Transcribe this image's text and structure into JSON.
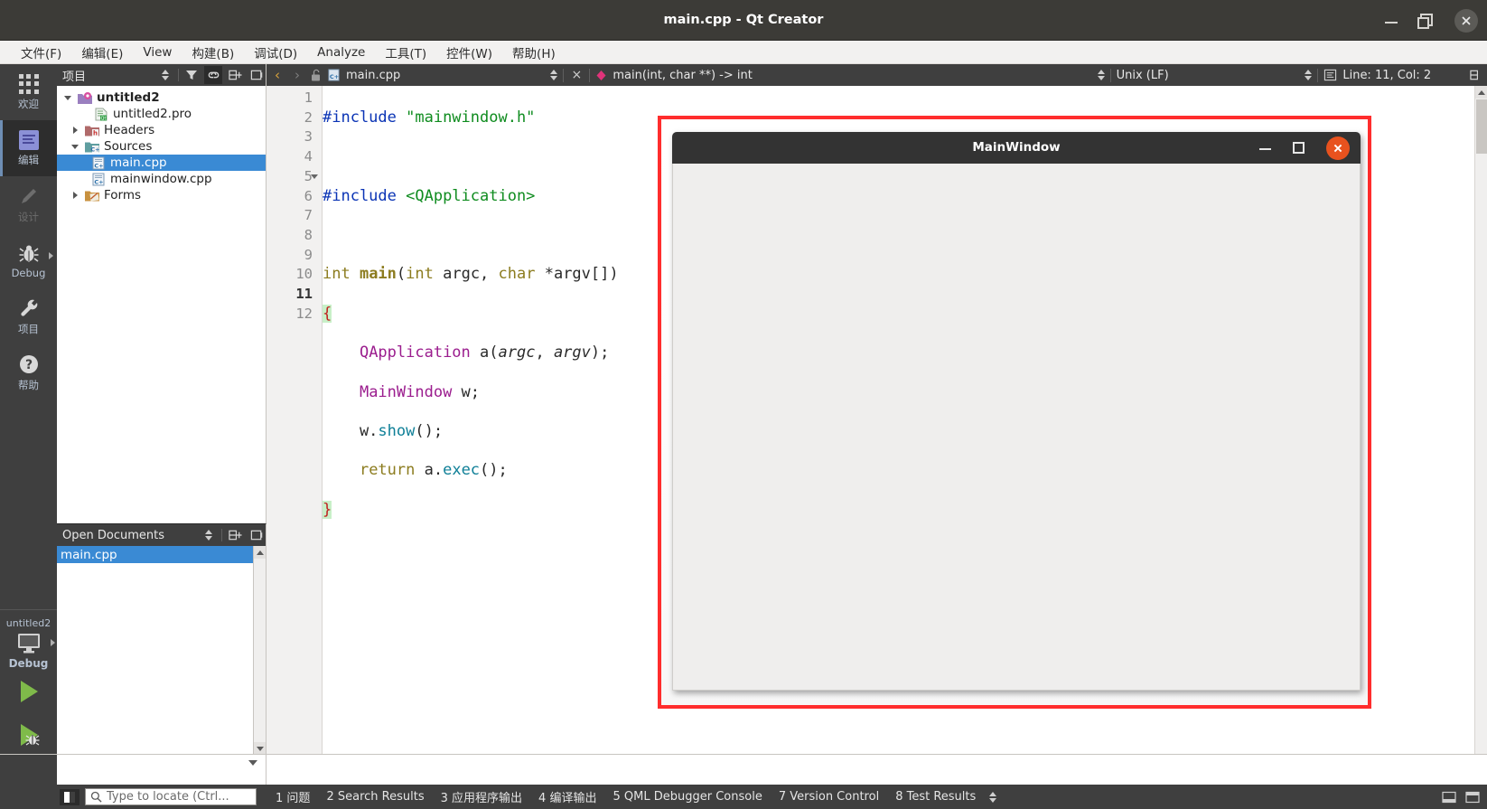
{
  "titlebar": {
    "title": "main.cpp - Qt Creator",
    "minimize": "minimize",
    "restore": "restore",
    "close": "close"
  },
  "menubar": {
    "items": [
      {
        "label": "文件(F)",
        "mnemonic": "F"
      },
      {
        "label": "编辑(E)",
        "mnemonic": "E"
      },
      {
        "label": "View",
        "mnemonic": "V"
      },
      {
        "label": "构建(B)",
        "mnemonic": "B"
      },
      {
        "label": "调试(D)",
        "mnemonic": "D"
      },
      {
        "label": "Analyze",
        "mnemonic": "A"
      },
      {
        "label": "工具(T)",
        "mnemonic": "T"
      },
      {
        "label": "控件(W)",
        "mnemonic": "W"
      },
      {
        "label": "帮助(H)",
        "mnemonic": "H"
      }
    ]
  },
  "modebar": {
    "items": [
      {
        "label": "欢迎",
        "icon": "grid-icon",
        "state": "normal"
      },
      {
        "label": "编辑",
        "icon": "edit-document-icon",
        "state": "active"
      },
      {
        "label": "设计",
        "icon": "pencil-icon",
        "state": "disabled"
      },
      {
        "label": "Debug",
        "icon": "bug-icon",
        "state": "normal"
      },
      {
        "label": "项目",
        "icon": "wrench-icon",
        "state": "normal"
      },
      {
        "label": "帮助",
        "icon": "question-mark-icon",
        "state": "normal"
      }
    ],
    "kit": {
      "project": "untitled2",
      "build_config": "Debug",
      "icon": "monitor-icon",
      "run_label": "run",
      "debug_label": "start-debugging",
      "build_label": "build"
    }
  },
  "project_pane": {
    "title": "项目",
    "toolbar_icons": [
      "sort-icon",
      "filter-icon",
      "link-icon",
      "split-icon",
      "close-icon"
    ],
    "tree": [
      {
        "label": "untitled2",
        "icon": "qt-project-icon",
        "depth": 0,
        "expander": "down",
        "bold": true,
        "selected": false
      },
      {
        "label": "untitled2.pro",
        "icon": "pro-file-icon",
        "depth": 1,
        "expander": "none",
        "bold": false,
        "selected": false
      },
      {
        "label": "Headers",
        "icon": "headers-folder-icon",
        "depth": 1,
        "expander": "right",
        "bold": false,
        "selected": false
      },
      {
        "label": "Sources",
        "icon": "sources-folder-icon",
        "depth": 1,
        "expander": "down",
        "bold": false,
        "selected": false
      },
      {
        "label": "main.cpp",
        "icon": "cpp-file-icon",
        "depth": 2,
        "expander": "none",
        "bold": false,
        "selected": true
      },
      {
        "label": "mainwindow.cpp",
        "icon": "cpp-file-icon",
        "depth": 2,
        "expander": "none",
        "bold": false,
        "selected": false
      },
      {
        "label": "Forms",
        "icon": "forms-folder-icon",
        "depth": 1,
        "expander": "right",
        "bold": false,
        "selected": false
      }
    ]
  },
  "open_documents": {
    "title": "Open Documents",
    "toolbar_icons": [
      "sort-icon",
      "split-icon",
      "close-icon"
    ],
    "items": [
      {
        "label": "main.cpp",
        "selected": true
      }
    ]
  },
  "editor_toolbar": {
    "back": "‹",
    "forward": "›",
    "lock_icon": "unlocked-icon",
    "file_icon": "cpp-file-icon",
    "filename": "main.cpp",
    "close_tab": "×",
    "symbol_icon": "function-symbol-icon",
    "symbol": "main(int, char **) -> int",
    "line_ending": "Unix (LF)",
    "text_encoding_icon": "text-settings-icon",
    "cursor_position": "Line: 11, Col: 2",
    "split_icon": "split-icon"
  },
  "editor": {
    "lines": [
      {
        "n": 1,
        "fold": false,
        "tokens": [
          {
            "t": "#include ",
            "c": "k-pre"
          },
          {
            "t": "\"mainwindow.h\"",
            "c": "k-str"
          }
        ]
      },
      {
        "n": 2,
        "fold": false,
        "tokens": []
      },
      {
        "n": 3,
        "fold": false,
        "tokens": [
          {
            "t": "#include ",
            "c": "k-pre"
          },
          {
            "t": "<QApplication>",
            "c": "k-str"
          }
        ]
      },
      {
        "n": 4,
        "fold": false,
        "tokens": []
      },
      {
        "n": 5,
        "fold": true,
        "tokens": [
          {
            "t": "int ",
            "c": "k-type"
          },
          {
            "t": "main",
            "c": "k-fn"
          },
          {
            "t": "(",
            "c": "k-plain"
          },
          {
            "t": "int",
            "c": "k-type"
          },
          {
            "t": " argc, ",
            "c": "k-plain"
          },
          {
            "t": "char",
            "c": "k-type"
          },
          {
            "t": " *argv[])",
            "c": "k-plain"
          }
        ]
      },
      {
        "n": 6,
        "fold": false,
        "tokens": [
          {
            "t": "{",
            "c": "k-brace"
          }
        ]
      },
      {
        "n": 7,
        "fold": false,
        "tokens": [
          {
            "t": "    ",
            "c": "k-plain"
          },
          {
            "t": "QApplication",
            "c": "k-cls"
          },
          {
            "t": " a(",
            "c": "k-plain"
          },
          {
            "t": "argc",
            "c": "k-var"
          },
          {
            "t": ", ",
            "c": "k-plain"
          },
          {
            "t": "argv",
            "c": "k-var"
          },
          {
            "t": ");",
            "c": "k-plain"
          }
        ]
      },
      {
        "n": 8,
        "fold": false,
        "tokens": [
          {
            "t": "    ",
            "c": "k-plain"
          },
          {
            "t": "MainWindow",
            "c": "k-cls"
          },
          {
            "t": " w;",
            "c": "k-plain"
          }
        ]
      },
      {
        "n": 9,
        "fold": false,
        "tokens": [
          {
            "t": "    w.",
            "c": "k-plain"
          },
          {
            "t": "show",
            "c": "k-mem"
          },
          {
            "t": "();",
            "c": "k-plain"
          }
        ]
      },
      {
        "n": 10,
        "fold": false,
        "tokens": [
          {
            "t": "    ",
            "c": "k-plain"
          },
          {
            "t": "return",
            "c": "k-type"
          },
          {
            "t": " a.",
            "c": "k-plain"
          },
          {
            "t": "exec",
            "c": "k-mem"
          },
          {
            "t": "();",
            "c": "k-plain"
          }
        ]
      },
      {
        "n": 11,
        "fold": false,
        "current": true,
        "tokens": [
          {
            "t": "}",
            "c": "k-brace"
          }
        ]
      },
      {
        "n": 12,
        "fold": false,
        "tokens": []
      }
    ]
  },
  "mainwindow_app": {
    "title": "MainWindow",
    "minimize": "minimize",
    "maximize": "maximize",
    "close": "close",
    "close_color": "#e8521e",
    "annotation_color": "#ff2d2d"
  },
  "statusbar": {
    "sidebar_toggle_icon": "sidebar-toggle-icon",
    "locator_icon": "search-icon",
    "locator_placeholder": "Type to locate (Ctrl...",
    "output_buttons": [
      {
        "num": "1",
        "label": "问题"
      },
      {
        "num": "2",
        "label": "Search Results"
      },
      {
        "num": "3",
        "label": "应用程序输出"
      },
      {
        "num": "4",
        "label": "编译输出"
      },
      {
        "num": "5",
        "label": "QML Debugger Console"
      },
      {
        "num": "7",
        "label": "Version Control"
      },
      {
        "num": "8",
        "label": "Test Results"
      }
    ],
    "more_icon": "updown-icon",
    "right_icons": [
      "minimize-pane-icon",
      "maximize-pane-icon"
    ]
  }
}
